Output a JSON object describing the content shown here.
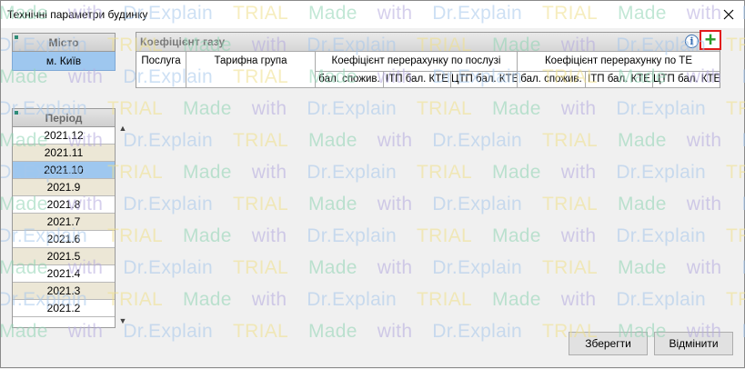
{
  "window": {
    "title": "Технічні параметри будинку"
  },
  "city": {
    "header": "Місто",
    "value": "м. Київ"
  },
  "period": {
    "header": "Період",
    "items": [
      "2021.12",
      "2021.11",
      "2021.10",
      "2021.9",
      "2021.8",
      "2021.7",
      "2021.6",
      "2021.5",
      "2021.4",
      "2021.3",
      "2021.2"
    ],
    "selected_index": 2
  },
  "gas": {
    "title": "Коефіцієнт газу",
    "columns": {
      "service": "Послуга",
      "tariff_group": "Тарифна група",
      "group_service": "Коефіцієнт перерахунку по послузі",
      "group_te": "Коефіцієнт перерахунку по ТЕ",
      "sub": [
        "бал. спожив.",
        "ІТП бал. КТЕ",
        "ЦТП бал. КТЕ",
        "бал. спожив.",
        "ІТП бал. КТЕ",
        "ЦТП бал. КТЕ"
      ]
    }
  },
  "buttons": {
    "save": "Зберегти",
    "cancel": "Відмінити"
  },
  "watermark": {
    "made": "Made",
    "with": "with",
    "dr": "Dr.Explain",
    "trial": "TRIAL"
  },
  "colors": {
    "selection": "#9ec7ef",
    "alt_row": "#ece7d6",
    "add_icon": "#2b9c2b",
    "highlight_box": "#e31b1b"
  }
}
